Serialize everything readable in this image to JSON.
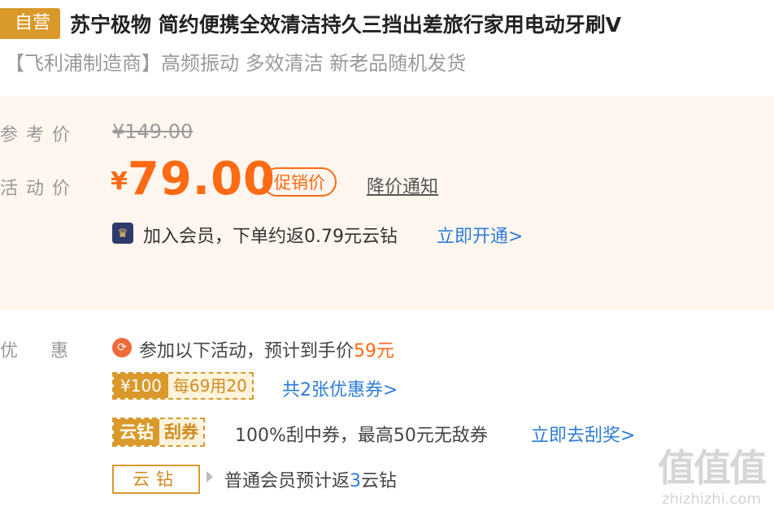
{
  "header": {
    "tag": "自营",
    "title": "苏宁极物 简约便携全效清洁持久三挡出差旅行家用电动牙刷V",
    "subtitle": "【飞利浦制造商】高频振动 多效清洁 新老品随机发货"
  },
  "price": {
    "ref_label": "参考价",
    "ref_price": "¥149.00",
    "activity_label": "活动价",
    "currency": "¥",
    "activity_price": "79.00",
    "promo_tag": "促销价",
    "price_alert": "降价通知"
  },
  "membership": {
    "icon": "crown-icon",
    "text": "加入会员，下单约返0.79元云钻",
    "link": "立即开通>"
  },
  "discount": {
    "label": "优惠",
    "promo_prefix": "参加以下活动，预计到手价",
    "promo_price": "59元",
    "coupon_amount": "¥100",
    "coupon_rule": "每69用20",
    "coupon_count": "共2张优惠券>",
    "scratch_a": "云钻",
    "scratch_b": "刮券",
    "scratch_text": "100%刮中券，最高50元无敌券",
    "scratch_link": "立即去刮奖>",
    "yunzuan_tag": "云钻",
    "yunzuan_prefix": "普通会员预计返",
    "yunzuan_num": "3",
    "yunzuan_suffix": "云钻"
  },
  "watermark": {
    "logo": "值值值",
    "site": "zhizhizhi.com"
  },
  "colors": {
    "accent_orange": "#ff6a14",
    "gold": "#d99a2b",
    "link_blue": "#2e7cd8",
    "panel_bg": "#fff6ef"
  }
}
